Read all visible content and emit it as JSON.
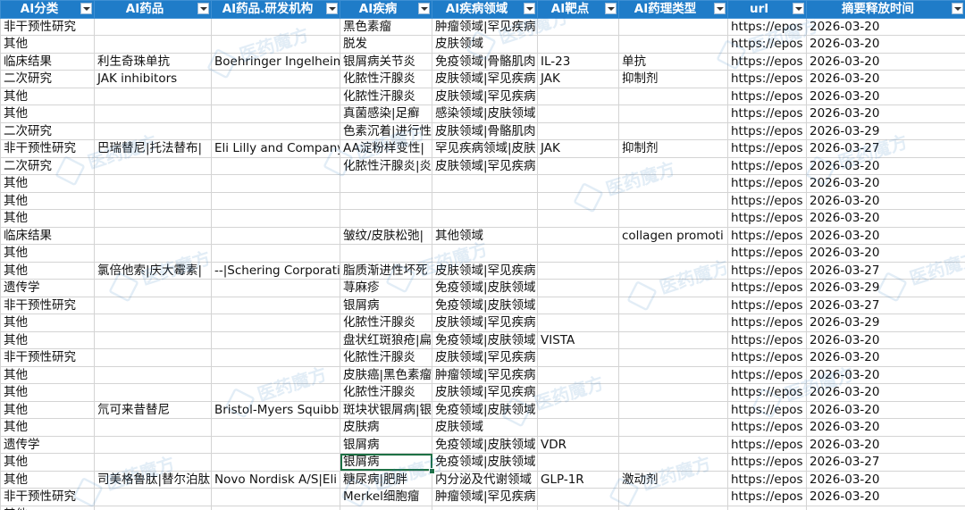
{
  "columns": [
    "AI分类",
    "AI药品",
    "AI药品.研发机构",
    "AI疾病",
    "AI疾病领域",
    "AI靶点",
    "AI药理类型",
    "url",
    "摘要释放时间"
  ],
  "rows": [
    [
      "非干预性研究",
      "",
      "",
      "黑色素瘤",
      "肿瘤领域|罕见疾病",
      "",
      "",
      "https://epos",
      "2026-03-20"
    ],
    [
      "其他",
      "",
      "",
      "脱发",
      "皮肤领域",
      "",
      "",
      "https://epos",
      "2026-03-20"
    ],
    [
      "临床结果",
      "利生奇珠单抗",
      "Boehringer Ingelheim",
      "银屑病关节炎",
      "免疫领域|骨骼肌肉",
      "IL-23",
      "单抗",
      "https://epos",
      "2026-03-20"
    ],
    [
      "二次研究",
      "JAK inhibitors",
      "",
      "化脓性汗腺炎",
      "皮肤领域|罕见疾病",
      "JAK",
      "抑制剂",
      "https://epos",
      "2026-03-20"
    ],
    [
      "其他",
      "",
      "",
      "化脓性汗腺炎",
      "皮肤领域|罕见疾病",
      "",
      "",
      "https://epos",
      "2026-03-20"
    ],
    [
      "其他",
      "",
      "",
      "真菌感染|足癣",
      "感染领域|皮肤领域",
      "",
      "",
      "https://epos",
      "2026-03-20"
    ],
    [
      "二次研究",
      "",
      "",
      "色素沉着|进行性",
      "皮肤领域|骨骼肌肉",
      "",
      "",
      "https://epos",
      "2026-03-29"
    ],
    [
      "非干预性研究",
      "巴瑞替尼|托法替布|",
      "Eli Lilly and Company",
      "AA淀粉样变性|",
      "罕见疾病领域|皮肤",
      "JAK",
      "抑制剂",
      "https://epos",
      "2026-03-27"
    ],
    [
      "二次研究",
      "",
      "",
      "化脓性汗腺炎|炎",
      "皮肤领域|罕见疾病",
      "",
      "",
      "https://epos",
      "2026-03-20"
    ],
    [
      "其他",
      "",
      "",
      "",
      "",
      "",
      "",
      "https://epos",
      "2026-03-20"
    ],
    [
      "其他",
      "",
      "",
      "",
      "",
      "",
      "",
      "https://epos",
      "2026-03-20"
    ],
    [
      "其他",
      "",
      "",
      "",
      "",
      "",
      "",
      "https://epos",
      "2026-03-20"
    ],
    [
      "临床结果",
      "",
      "",
      "皱纹/皮肤松弛|",
      "其他领域",
      "",
      "collagen promoti",
      "https://epos",
      "2026-03-20"
    ],
    [
      "其他",
      "",
      "",
      "",
      "",
      "",
      "",
      "https://epos",
      "2026-03-20"
    ],
    [
      "其他",
      "氯倍他索|庆大霉素|",
      "--|Schering Corporati",
      "脂质渐进性坏死",
      "皮肤领域|罕见疾病",
      "",
      "",
      "https://epos",
      "2026-03-27"
    ],
    [
      "遗传学",
      "",
      "",
      "荨麻疹",
      "免疫领域|皮肤领域",
      "",
      "",
      "https://epos",
      "2026-03-29"
    ],
    [
      "非干预性研究",
      "",
      "",
      "银屑病",
      "免疫领域|皮肤领域",
      "",
      "",
      "https://epos",
      "2026-03-27"
    ],
    [
      "其他",
      "",
      "",
      "化脓性汗腺炎",
      "皮肤领域|罕见疾病",
      "",
      "",
      "https://epos",
      "2026-03-29"
    ],
    [
      "其他",
      "",
      "",
      "盘状红斑狼疮|扁",
      "免疫领域|皮肤领域",
      "VISTA",
      "",
      "https://epos",
      "2026-03-20"
    ],
    [
      "非干预性研究",
      "",
      "",
      "化脓性汗腺炎",
      "皮肤领域|罕见疾病",
      "",
      "",
      "https://epos",
      "2026-03-20"
    ],
    [
      "其他",
      "",
      "",
      "皮肤癌|黑色素瘤",
      "肿瘤领域|罕见疾病",
      "",
      "",
      "https://epos",
      "2026-03-20"
    ],
    [
      "其他",
      "",
      "",
      "化脓性汗腺炎",
      "皮肤领域|罕见疾病",
      "",
      "",
      "https://epos",
      "2026-03-20"
    ],
    [
      "其他",
      "氘可来昔替尼",
      "Bristol-Myers Squibb",
      "斑块状银屑病|银",
      "免疫领域|皮肤领域",
      "",
      "",
      "https://epos",
      "2026-03-20"
    ],
    [
      "其他",
      "",
      "",
      "皮肤病",
      "皮肤领域",
      "",
      "",
      "https://epos",
      "2026-03-20"
    ],
    [
      "遗传学",
      "",
      "",
      "银屑病",
      "免疫领域|皮肤领域",
      "VDR",
      "",
      "https://epos",
      "2026-03-20"
    ],
    [
      "其他",
      "",
      "",
      "银屑病",
      "免疫领域|皮肤领域",
      "",
      "",
      "https://epos",
      "2026-03-27"
    ],
    [
      "其他",
      "司美格鲁肽|替尔泊肽",
      "Novo Nordisk A/S|Eli",
      "糖尿病|肥胖",
      "内分泌及代谢领域",
      "GLP-1R",
      "激动剂",
      "https://epos",
      "2026-03-20"
    ],
    [
      "非干预性研究",
      "",
      "",
      "Merkel细胞瘤",
      "肿瘤领域|罕见疾病",
      "",
      "",
      "https://epos",
      "2026-03-20"
    ],
    [
      "其他",
      "",
      "",
      "",
      "",
      "",
      "",
      "",
      ""
    ]
  ],
  "selected_cell": {
    "row": 25,
    "col": 3
  },
  "watermark_text": "医药魔方",
  "colors": {
    "header_bg": "#1f7cc8",
    "header_text": "#ffffff",
    "grid": "#d4d4d4",
    "selection": "#1e7145"
  }
}
